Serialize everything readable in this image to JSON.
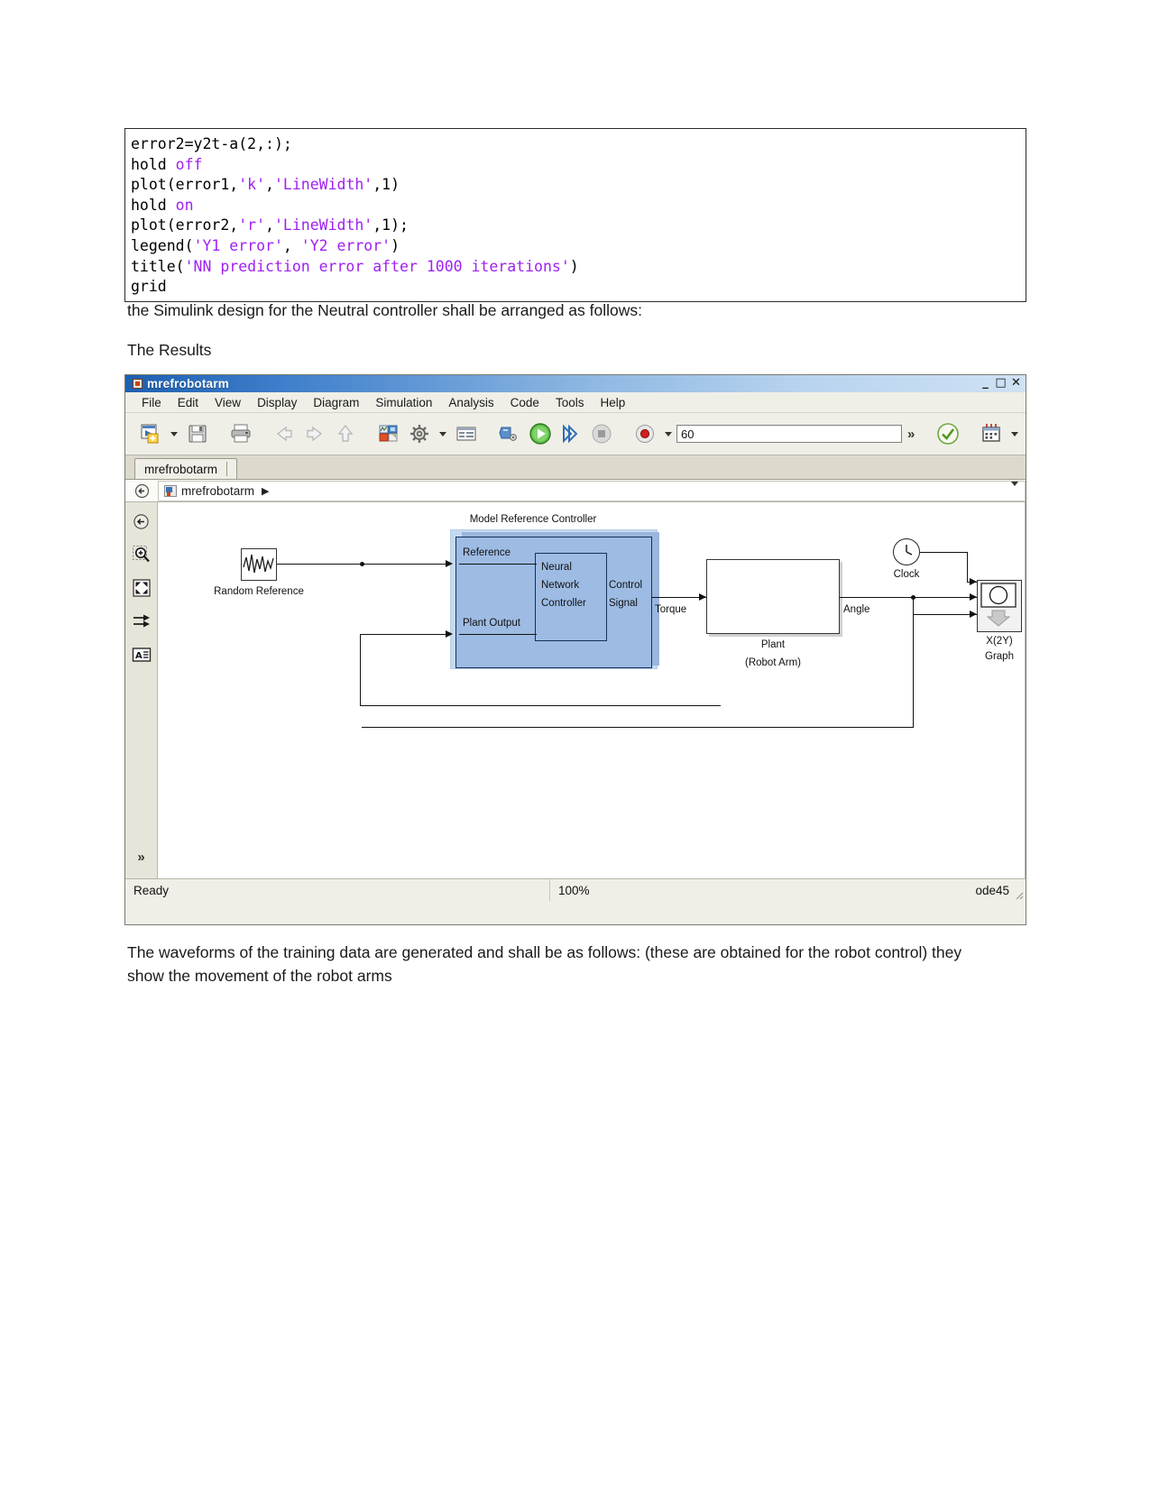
{
  "document": {
    "code_lines": [
      {
        "segments": [
          {
            "t": "error2=y2t-a(2,:);",
            "c": "plain"
          }
        ]
      },
      {
        "segments": [
          {
            "t": "hold ",
            "c": "plain"
          },
          {
            "t": "off",
            "c": "kw"
          }
        ]
      },
      {
        "segments": [
          {
            "t": "plot(error1,",
            "c": "plain"
          },
          {
            "t": "'k'",
            "c": "str"
          },
          {
            "t": ",",
            "c": "plain"
          },
          {
            "t": "'LineWidth'",
            "c": "str"
          },
          {
            "t": ",1)",
            "c": "plain"
          }
        ]
      },
      {
        "segments": [
          {
            "t": "hold ",
            "c": "plain"
          },
          {
            "t": "on",
            "c": "kw"
          }
        ]
      },
      {
        "segments": [
          {
            "t": "plot(error2,",
            "c": "plain"
          },
          {
            "t": "'r'",
            "c": "str"
          },
          {
            "t": ",",
            "c": "plain"
          },
          {
            "t": "'LineWidth'",
            "c": "str"
          },
          {
            "t": ",1);",
            "c": "plain"
          }
        ]
      },
      {
        "segments": [
          {
            "t": "legend(",
            "c": "plain"
          },
          {
            "t": "'Y1 error'",
            "c": "str"
          },
          {
            "t": ", ",
            "c": "plain"
          },
          {
            "t": "'Y2 error'",
            "c": "str"
          },
          {
            "t": ")",
            "c": "plain"
          }
        ]
      },
      {
        "segments": [
          {
            "t": "title(",
            "c": "plain"
          },
          {
            "t": "'NN prediction error after 1000 iterations'",
            "c": "str"
          },
          {
            "t": ")",
            "c": "plain"
          }
        ]
      },
      {
        "segments": [
          {
            "t": "grid",
            "c": "plain"
          }
        ]
      }
    ],
    "paragraph_simulink": "the Simulink design for the Neutral controller shall be arranged as follows:",
    "heading_results": "The Results",
    "paragraph_waveforms": "The waveforms of the training data are generated and shall be as follows: (these are obtained for the robot control) they show the movement of the robot arms"
  },
  "simulink_window": {
    "title": "mrefrobotarm",
    "window_buttons": [
      {
        "name": "minimize",
        "glyph": "_"
      },
      {
        "name": "maximize",
        "glyph": "□"
      },
      {
        "name": "close",
        "glyph": "✕"
      }
    ],
    "menu": [
      "File",
      "Edit",
      "View",
      "Display",
      "Diagram",
      "Simulation",
      "Analysis",
      "Code",
      "Tools",
      "Help"
    ],
    "toolbar": {
      "new_model": "new-model-icon",
      "save": "save-icon",
      "print": "print-icon",
      "back": "back-arrow-icon",
      "forward": "forward-arrow-icon",
      "up": "up-arrow-icon",
      "library_browser": "library-browser-icon",
      "model_config": "model-configuration-icon",
      "model_explorer": "model-explorer-icon",
      "update_model": "update-model-icon",
      "run": "run-icon",
      "step_forward": "step-forward-icon",
      "stop": "stop-icon",
      "record": "record-icon",
      "simulation_time": "60",
      "overflow": "»",
      "model_advisor": "model-advisor-check-icon",
      "schedule": "schedule-editor-icon"
    },
    "tab_label": "mrefrobotarm",
    "breadcrumb": {
      "model": "mrefrobotarm",
      "separator": "▶"
    },
    "sidebar_icons": [
      "navigate-back-icon",
      "zoom-in-icon",
      "fit-to-view-icon",
      "signal-routing-icon",
      "annotation-icon",
      "expand-panel-icon"
    ],
    "status_bar": {
      "state": "Ready",
      "zoom": "100%",
      "solver": "ode45"
    }
  },
  "diagram": {
    "labels": {
      "model_reference_controller": "Model Reference Controller",
      "random_reference": "Random Reference",
      "reference_port": "Reference",
      "plant_output_port": "Plant Output",
      "neural_network_controller": [
        "Neural",
        "Network",
        "Controller"
      ],
      "control_signal": [
        "Control",
        "Signal"
      ],
      "torque": "Torque",
      "angle": "Angle",
      "plant_line1": "Plant",
      "plant_line2": "(Robot Arm)",
      "clock": "Clock",
      "graph_line1": "X(2Y)",
      "graph_line2": "Graph"
    },
    "colors": {
      "controller_fill": "#9dbbe3",
      "controller_halo": "#c5d9f1",
      "controller_border": "#15305c",
      "wire": "#111111"
    }
  }
}
